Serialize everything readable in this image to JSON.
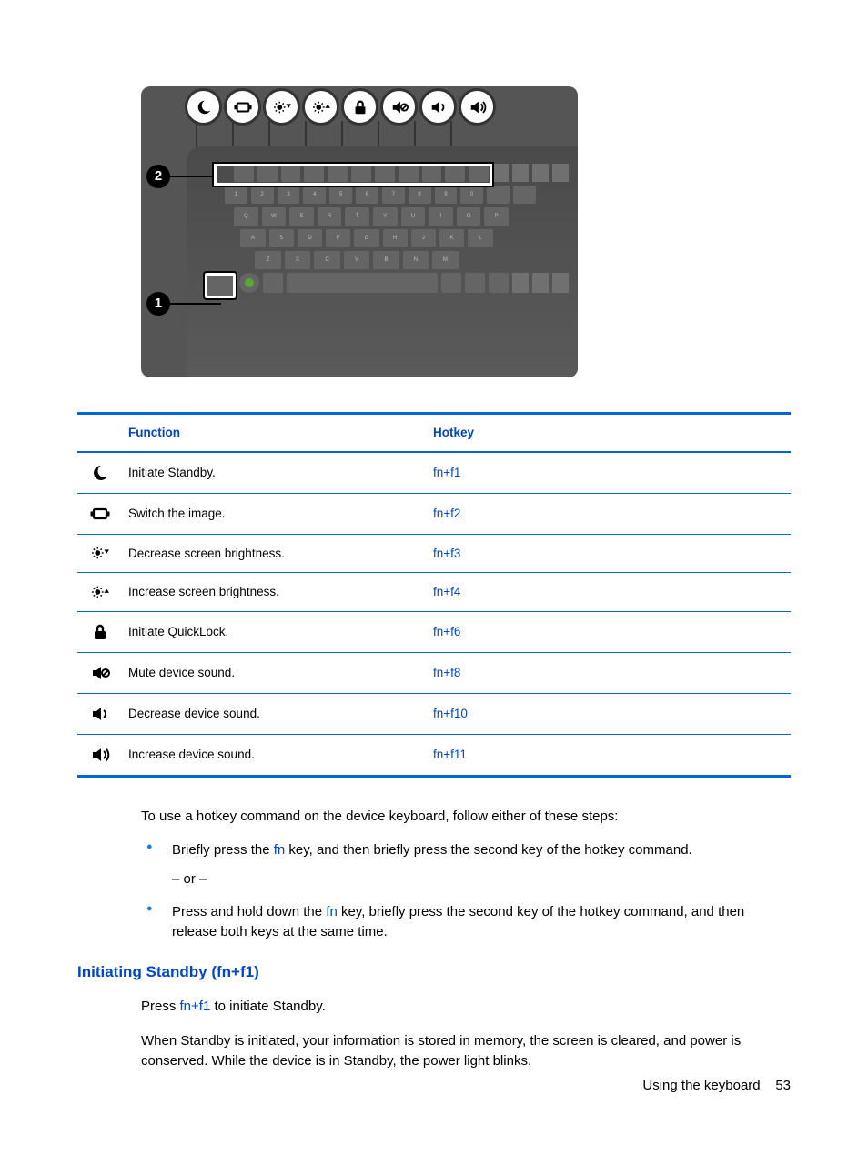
{
  "table": {
    "headers": {
      "function": "Function",
      "hotkey": "Hotkey"
    },
    "rows": [
      {
        "icon": "moon",
        "function": "Initiate Standby.",
        "hotkey": "fn+f1"
      },
      {
        "icon": "switch",
        "function": "Switch the image.",
        "hotkey": "fn+f2"
      },
      {
        "icon": "bright-down",
        "function": "Decrease screen brightness.",
        "hotkey": "fn+f3"
      },
      {
        "icon": "bright-up",
        "function": "Increase screen brightness.",
        "hotkey": "fn+f4"
      },
      {
        "icon": "lock",
        "function": "Initiate QuickLock.",
        "hotkey": "fn+f6"
      },
      {
        "icon": "mute",
        "function": "Mute device sound.",
        "hotkey": "fn+f8"
      },
      {
        "icon": "vol-down",
        "function": "Decrease device sound.",
        "hotkey": "fn+f10"
      },
      {
        "icon": "vol-up",
        "function": "Increase device sound.",
        "hotkey": "fn+f11"
      }
    ]
  },
  "figure": {
    "callouts": {
      "1": "1",
      "2": "2"
    },
    "top_icons": [
      "moon",
      "switch",
      "bright-down",
      "bright-up",
      "lock",
      "mute",
      "vol-down",
      "vol-up"
    ]
  },
  "text": {
    "intro": "To use a hotkey command on the device keyboard, follow either of these steps:",
    "bullet1_a": "Briefly press the ",
    "bullet1_fn": "fn",
    "bullet1_b": " key, and then briefly press the second key of the hotkey command.",
    "or": "– or –",
    "bullet2_a": "Press and hold down the ",
    "bullet2_fn": "fn",
    "bullet2_b": " key, briefly press the second key of the hotkey command, and then release both keys at the same time.",
    "heading": "Initiating Standby (fn+f1)",
    "p1_a": "Press ",
    "p1_fn": "fn+f1",
    "p1_b": " to initiate Standby.",
    "p2": "When Standby is initiated, your information is stored in memory, the screen is cleared, and power is conserved. While the device is in Standby, the power light blinks."
  },
  "footer": {
    "section": "Using the keyboard",
    "page": "53"
  }
}
